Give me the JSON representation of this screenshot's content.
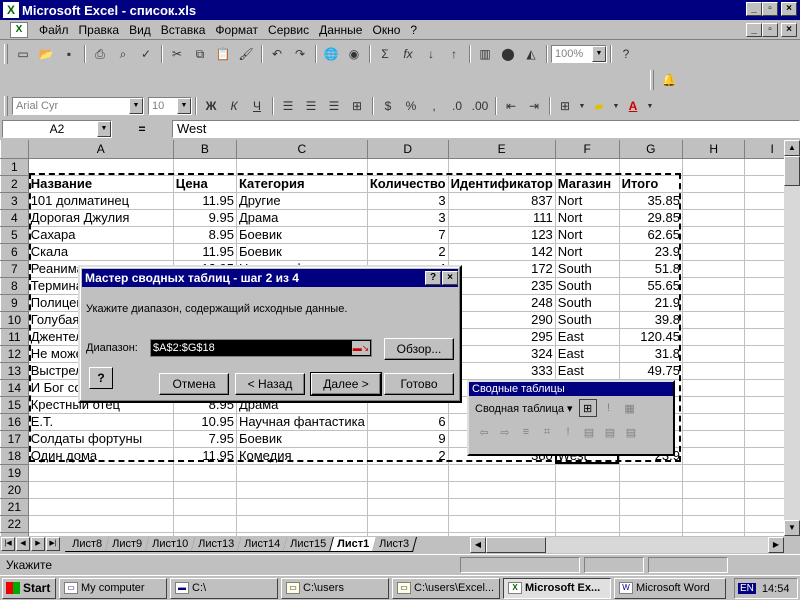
{
  "window": {
    "title": "Microsoft Excel - список.xls",
    "app_icon": "X",
    "controls": [
      "_",
      "▫",
      "×"
    ]
  },
  "menu": {
    "items": [
      {
        "label": "Файл",
        "key": "Ф"
      },
      {
        "label": "Правка",
        "key": "П"
      },
      {
        "label": "Вид",
        "key": "В"
      },
      {
        "label": "Вставка",
        "key": "а"
      },
      {
        "label": "Формат",
        "key": "о"
      },
      {
        "label": "Сервис",
        "key": "С"
      },
      {
        "label": "Данные",
        "key": "Д"
      },
      {
        "label": "Окно",
        "key": "О"
      },
      {
        "label": "?",
        "key": "?"
      }
    ]
  },
  "toolbar": {
    "zoom": "100%"
  },
  "format_toolbar": {
    "font": "Arial Cyr",
    "size": "10",
    "bold": "Ж",
    "italic": "К",
    "underline": "Ч",
    "percent": "%",
    "thousands": ","
  },
  "formula_bar": {
    "cell": "A2",
    "equals": "=",
    "value": "West"
  },
  "sheet": {
    "columns": [
      "",
      "A",
      "B",
      "C",
      "D",
      "E",
      "F",
      "G",
      "H",
      "I"
    ],
    "rows": [
      {
        "n": "1",
        "cells": [
          "",
          "",
          "",
          "",
          "",
          "",
          "",
          "",
          ""
        ]
      },
      {
        "n": "2",
        "cells": [
          "Название",
          "Цена",
          "Категория",
          "Количество",
          "Идентификатор",
          "Магазин",
          "Итого",
          "",
          ""
        ]
      },
      {
        "n": "3",
        "cells": [
          "101 долматинец",
          "11.95",
          "Другие",
          "3",
          "837",
          "Nort",
          "35.85",
          "",
          ""
        ]
      },
      {
        "n": "4",
        "cells": [
          "Дорогая Джулия",
          "9.95",
          "Драма",
          "3",
          "111",
          "Nort",
          "29.85",
          "",
          ""
        ]
      },
      {
        "n": "5",
        "cells": [
          "Сахара",
          "8.95",
          "Боевик",
          "7",
          "123",
          "Nort",
          "62.65",
          "",
          ""
        ]
      },
      {
        "n": "6",
        "cells": [
          "Скала",
          "11.95",
          "Боевик",
          "2",
          "142",
          "Nort",
          "23.9",
          "",
          ""
        ]
      },
      {
        "n": "7",
        "cells": [
          "Реаниматор",
          "12.95",
          "Научная фантастика",
          "4",
          "172",
          "South",
          "51.8",
          "",
          ""
        ]
      },
      {
        "n": "8",
        "cells": [
          "Терминатор",
          "",
          "",
          "",
          "235",
          "South",
          "55.65",
          "",
          ""
        ]
      },
      {
        "n": "9",
        "cells": [
          "Полицейский",
          "",
          "",
          "",
          "248",
          "South",
          "21.9",
          "",
          ""
        ]
      },
      {
        "n": "10",
        "cells": [
          "Голубая",
          "",
          "",
          "",
          "290",
          "South",
          "39.8",
          "",
          ""
        ]
      },
      {
        "n": "11",
        "cells": [
          "Джентельмены",
          "",
          "",
          "",
          "295",
          "East",
          "120.45",
          "",
          ""
        ]
      },
      {
        "n": "12",
        "cells": [
          "Не может быть",
          "",
          "",
          "",
          "324",
          "East",
          "31.8",
          "",
          ""
        ]
      },
      {
        "n": "13",
        "cells": [
          "Выстрел",
          "",
          "",
          "",
          "333",
          "East",
          "49.75",
          "",
          ""
        ]
      },
      {
        "n": "14",
        "cells": [
          "И Бог создал",
          "",
          "",
          "",
          "",
          "",
          "",
          "",
          ""
        ]
      },
      {
        "n": "15",
        "cells": [
          "Крестный отец",
          "8.95",
          "Драма",
          "",
          "",
          "",
          "",
          "",
          ""
        ]
      },
      {
        "n": "16",
        "cells": [
          "Е.Т.",
          "10.95",
          "Научная фантастика",
          "6",
          "",
          "",
          "",
          "",
          ""
        ]
      },
      {
        "n": "17",
        "cells": [
          "Солдаты фортуны",
          "7.95",
          "Боевик",
          "9",
          "",
          "",
          "",
          "",
          ""
        ]
      },
      {
        "n": "18",
        "cells": [
          "Один дома",
          "11.95",
          "Комедия",
          "2",
          "380",
          "West",
          "23.9",
          "",
          ""
        ]
      },
      {
        "n": "19",
        "cells": [
          "",
          "",
          "",
          "",
          "",
          "",
          "",
          "",
          ""
        ]
      },
      {
        "n": "20",
        "cells": [
          "",
          "",
          "",
          "",
          "",
          "",
          "",
          "",
          ""
        ]
      },
      {
        "n": "21",
        "cells": [
          "",
          "",
          "",
          "",
          "",
          "",
          "",
          "",
          ""
        ]
      },
      {
        "n": "22",
        "cells": [
          "",
          "",
          "",
          "",
          "",
          "",
          "",
          "",
          ""
        ]
      },
      {
        "n": "23",
        "cells": [
          "",
          "",
          "",
          "",
          "",
          "",
          "",
          "",
          ""
        ]
      }
    ]
  },
  "tabs": [
    "Лист8",
    "Лист9",
    "Лист10",
    "Лист13",
    "Лист14",
    "Лист15",
    "Лист1",
    "Лист3"
  ],
  "active_tab": "Лист1",
  "status": {
    "text": "Укажите"
  },
  "dialog": {
    "title": "Мастер сводных таблиц - шаг 2 из 4",
    "help_icon": "?",
    "close_icon": "×",
    "instruction": "Укажите диапазон, содержащий исходные данные.",
    "range_label": "Диапазон:",
    "range_value": "$A$2:$G$18",
    "browse": "Обзор...",
    "cancel": "Отмена",
    "back": "< Назад",
    "next": "Далее >",
    "finish": "Готово"
  },
  "pivot_toolbar": {
    "title": "Сводные таблицы",
    "menu": "Сводная таблица ▾"
  },
  "taskbar": {
    "start": "Start",
    "tasks": [
      "My computer",
      "C:\\",
      "C:\\users",
      "C:\\users\\Excel...",
      "Microsoft Ex...",
      "Microsoft Word"
    ],
    "active": "Microsoft Ex...",
    "lang": "EN",
    "clock": "14:54"
  }
}
